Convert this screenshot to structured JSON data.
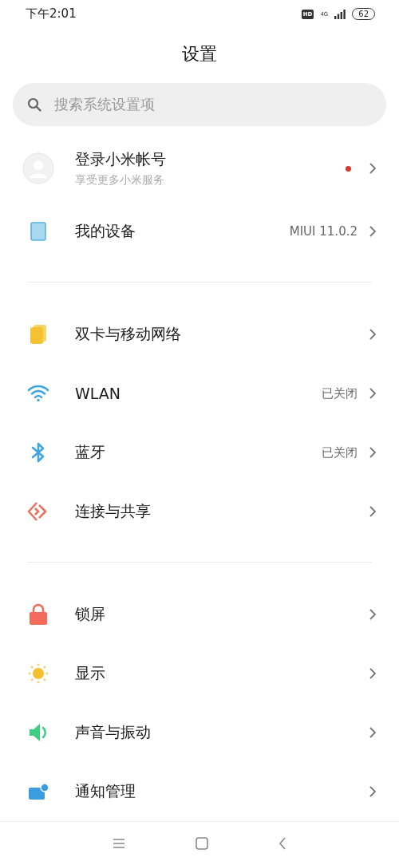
{
  "status_bar": {
    "time": "下午2:01",
    "hd": "HD",
    "network": "4G",
    "battery": "62"
  },
  "title": "设置",
  "search": {
    "placeholder": "搜索系统设置项"
  },
  "groups": [
    {
      "items": [
        {
          "kind": "account",
          "label": "登录小米帐号",
          "subtitle": "享受更多小米服务",
          "notification_dot": true
        },
        {
          "kind": "device",
          "label": "我的设备",
          "value": "MIUI 11.0.2"
        }
      ]
    },
    {
      "items": [
        {
          "kind": "sim",
          "label": "双卡与移动网络"
        },
        {
          "kind": "wlan",
          "label": "WLAN",
          "value": "已关闭"
        },
        {
          "kind": "bluetooth",
          "label": "蓝牙",
          "value": "已关闭"
        },
        {
          "kind": "share",
          "label": "连接与共享"
        }
      ]
    },
    {
      "items": [
        {
          "kind": "lock",
          "label": "锁屏"
        },
        {
          "kind": "display",
          "label": "显示"
        },
        {
          "kind": "sound",
          "label": "声音与振动"
        },
        {
          "kind": "notifications",
          "label": "通知管理"
        }
      ]
    }
  ]
}
